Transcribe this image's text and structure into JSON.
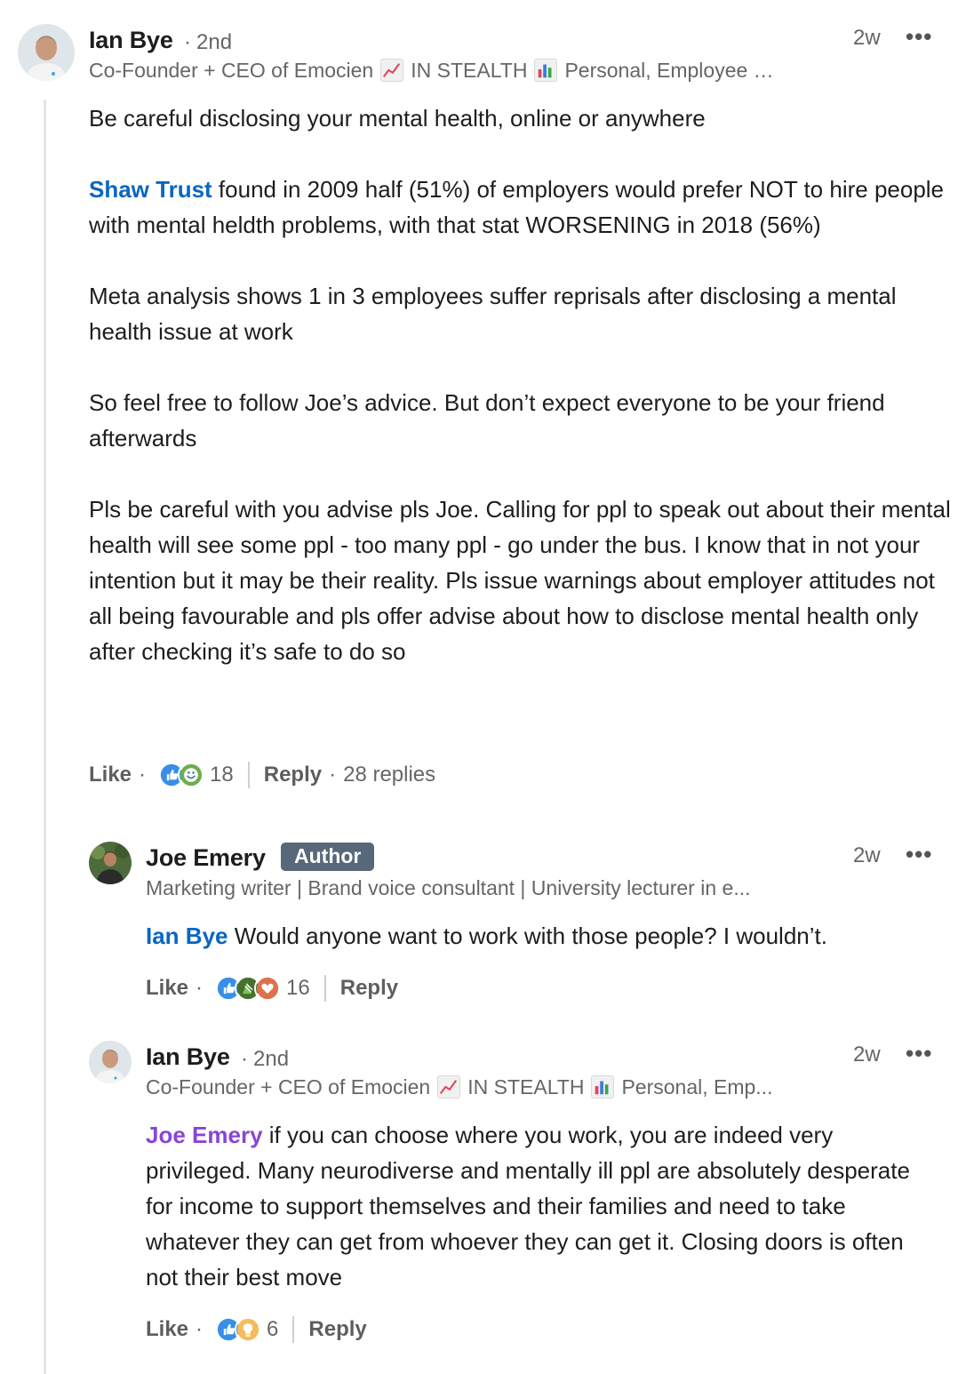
{
  "comments": [
    {
      "author": "Ian Bye",
      "degree": "2nd",
      "headline_parts": [
        "Co-Founder + CEO of Emocien",
        "IN STEALTH",
        "Personal, Employee …"
      ],
      "headline_icons": [
        "chart-increasing-emoji-icon",
        "bar-chart-emoji-icon"
      ],
      "time": "2w",
      "more": "•••",
      "paragraphs": [
        "Be careful disclosing your mental health, online or anywhere",
        {
          "mention": "Shaw Trust",
          "text": " found in 2009 half (51%) of employers would prefer NOT to hire people with mental heldth problems, with that stat WORSENING in 2018 (56%)"
        },
        "Meta analysis shows 1 in 3 employees suffer reprisals after disclosing a mental health issue at work",
        "So feel free to follow Joe’s advice. But don’t expect everyone to be your friend afterwards",
        "Pls be careful with you advise pls Joe. Calling for ppl to speak out about their mental health will see some ppl - too many ppl - go under the bus. I know that in not your intention but it may be their reality. Pls issue warnings about employer attitudes not all being favourable and pls offer advise about how to disclose mental health only after checking it’s safe to do so"
      ],
      "actions": {
        "like": "Like",
        "reaction_count": "18",
        "reactions": [
          "like",
          "support"
        ],
        "reply": "Reply",
        "replies": "28 replies"
      }
    },
    {
      "author": "Joe Emery",
      "badge": "Author",
      "headline": "Marketing writer | Brand voice consultant | University lecturer in e...",
      "time": "2w",
      "more": "•••",
      "mention": "Ian Bye",
      "text": " Would anyone want to work with those people? I wouldn’t.",
      "actions": {
        "like": "Like",
        "reaction_count": "16",
        "reactions": [
          "like",
          "celebrate",
          "love"
        ],
        "reply": "Reply"
      }
    },
    {
      "author": "Ian Bye",
      "degree": "2nd",
      "headline_parts": [
        "Co-Founder + CEO of Emocien",
        "IN STEALTH",
        "Personal, Emp..."
      ],
      "headline_icons": [
        "chart-increasing-emoji-icon",
        "bar-chart-emoji-icon"
      ],
      "time": "2w",
      "more": "•••",
      "mention": "Joe Emery",
      "paragraphs": [
        " if you can choose where you work, you are indeed very privileged. Many neurodiverse and mentally ill ppl are absolutely desperate for income to support themselves and their families and need to take whatever they can get from whoever they can get it. Closing doors is often not their best move"
      ],
      "actions": {
        "like": "Like",
        "reaction_count": "6",
        "reactions": [
          "like",
          "insightful"
        ],
        "reply": "Reply"
      }
    }
  ],
  "colors": {
    "mention_blue": "#0a66c2",
    "mention_purple": "#8a44d6",
    "secondary_text": "#666666",
    "badge_bg": "#56687a"
  }
}
